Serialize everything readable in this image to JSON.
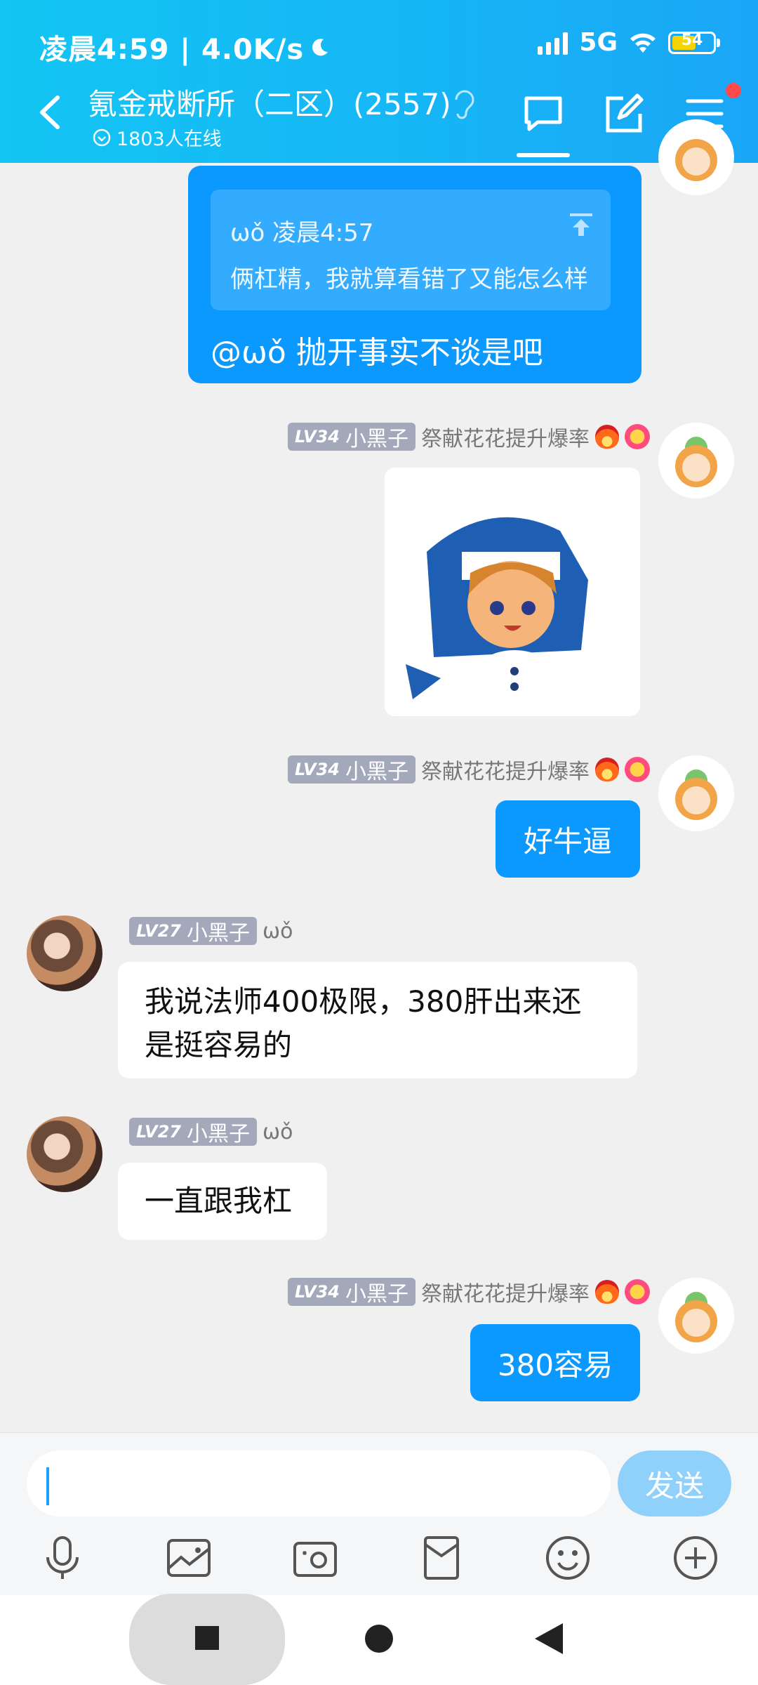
{
  "status_bar": {
    "time": "凌晨4:59 | 4.0K/s",
    "network": "5G",
    "battery": "54"
  },
  "header": {
    "title": "氪金戒断所（二区）(2557)",
    "online": "1803人在线"
  },
  "messages": [
    {
      "quote_author": "ωǒ 凌晨4:57",
      "quote_text": "俩杠精，我就算看错了又能怎么样",
      "text": "@ωǒ 抛开事实不谈是吧"
    },
    {
      "level": "LV34",
      "name": "小黑子",
      "title": "祭献花花提升爆率",
      "sticker": "shark-hood-girl-sticker"
    },
    {
      "level": "LV34",
      "name": "小黑子",
      "title": "祭献花花提升爆率",
      "text": "好牛逼"
    },
    {
      "level": "LV27",
      "name": "小黑子",
      "title": "ωǒ",
      "text": "我说法师400极限，380肝出来还是挺容易的"
    },
    {
      "level": "LV27",
      "name": "小黑子",
      "title": "ωǒ",
      "text": "一直跟我杠"
    },
    {
      "level": "LV34",
      "name": "小黑子",
      "title": "祭献花花提升爆率",
      "text": "380容易"
    }
  ],
  "composer": {
    "input_value": "",
    "send_label": "发送",
    "tools": [
      "microphone-icon",
      "image-icon",
      "camera-icon",
      "red-packet-icon",
      "emoji-icon",
      "plus-icon"
    ]
  },
  "colors": {
    "header": "#16b6f5",
    "bubble_me": "#0b99ff",
    "send_disabled": "#8fd1fb"
  }
}
